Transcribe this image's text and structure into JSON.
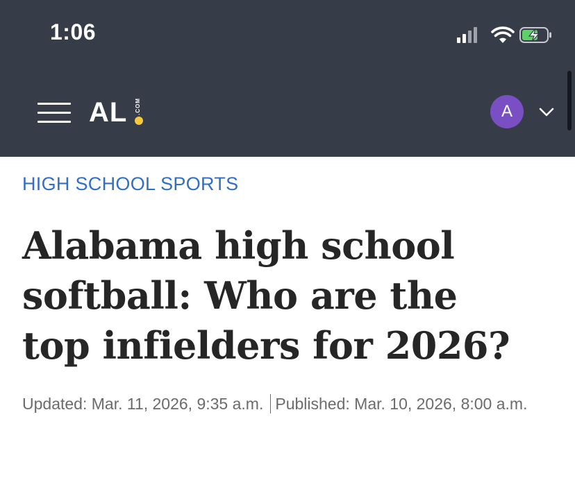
{
  "status_bar": {
    "time": "1:06",
    "icons": [
      "cellular-signal-icon",
      "wifi-icon",
      "battery-charging-icon"
    ]
  },
  "header": {
    "logo_text": "AL",
    "logo_suffix": ".COM",
    "avatar_initial": "A",
    "colors": {
      "background": "#363c48",
      "logo_dot": "#f5c840",
      "avatar": "#7b4fc4"
    }
  },
  "article": {
    "section": "HIGH SCHOOL SPORTS",
    "headline": "Alabama high school softball: Who are the top infielders for 2026?",
    "updated": "Updated: Mar. 11, 2026, 9:35 a.m.",
    "published": "Published: Mar. 10, 2026, 8:00 a.m.",
    "colors": {
      "section_label": "#2f6fc9",
      "headline": "#262626",
      "byline": "#6b6b6b"
    }
  }
}
